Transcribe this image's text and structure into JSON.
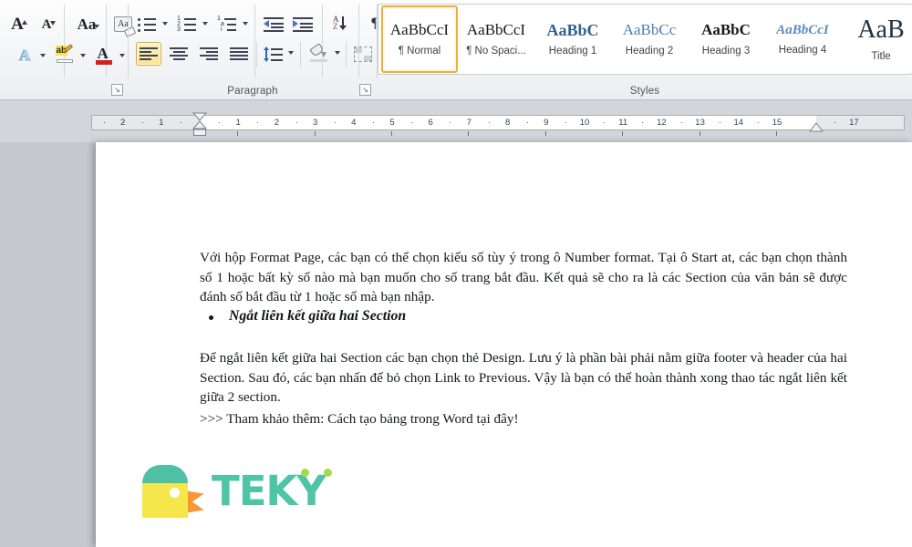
{
  "app": {
    "name": "Microsoft Word 2010 ribbon"
  },
  "ribbon": {
    "font_group": {
      "label": "",
      "buttons": [
        {
          "name": "grow-font",
          "glyph": "A"
        },
        {
          "name": "shrink-font",
          "glyph": "A"
        },
        {
          "name": "change-case",
          "glyph": "Aa"
        },
        {
          "name": "clear-formatting",
          "glyph": "A"
        },
        {
          "name": "text-effects",
          "glyph": "A"
        },
        {
          "name": "text-highlight-color",
          "glyph": "ab"
        },
        {
          "name": "font-color",
          "glyph": "A"
        }
      ]
    },
    "paragraph_group": {
      "label": "Paragraph",
      "row1": [
        "bullets",
        "numbering",
        "multilevel-list",
        "decrease-indent",
        "increase-indent",
        "sort",
        "show-formatting-marks"
      ],
      "row2": [
        "align-left",
        "center",
        "align-right",
        "justify",
        "line-spacing",
        "shading",
        "borders"
      ],
      "active": "align-left",
      "pilcrow": "¶",
      "sort_letters": {
        "top": "A",
        "bottom": "Z"
      }
    },
    "styles_group": {
      "label": "Styles",
      "items": [
        {
          "sample": "AaBbCcI",
          "name": "¶ Normal",
          "selected": true,
          "style": "normal"
        },
        {
          "sample": "AaBbCcI",
          "name": "¶ No Spaci...",
          "selected": false,
          "style": "nospacing"
        },
        {
          "sample": "AaBbC",
          "name": "Heading 1",
          "selected": false,
          "style": "h1"
        },
        {
          "sample": "AaBbCc",
          "name": "Heading 2",
          "selected": false,
          "style": "h2"
        },
        {
          "sample": "AaBbC",
          "name": "Heading 3",
          "selected": false,
          "style": "h3"
        },
        {
          "sample": "AaBbCcI",
          "name": "Heading 4",
          "selected": false,
          "style": "h4"
        },
        {
          "sample": "AaB",
          "name": "Title",
          "selected": false,
          "style": "title"
        }
      ]
    },
    "colors": {
      "selection_border": "#e0a829",
      "selection_fill": "#fbe293",
      "heading_blue": "#3a6ea5",
      "font_color_bar": "#d61f1f",
      "highlight_yellow": "#f7e64a"
    }
  },
  "ruler": {
    "left_labels": [
      "2",
      "1"
    ],
    "labels": [
      "1",
      "2",
      "3",
      "4",
      "5",
      "6",
      "7",
      "8",
      "9",
      "10",
      "11",
      "12",
      "13",
      "14",
      "15",
      "17"
    ],
    "left_indent_marker": "hourglass",
    "right_indent_marker": "triangle"
  },
  "document": {
    "paragraph1": "Với hộp Format Page, các bạn có thể chọn kiểu số tùy ý trong ô Number format. Tại ô Start at, các bạn chọn thành số 1 hoặc bất kỳ số nào mà bạn muốn cho số trang bắt đầu. Kết quả sẽ cho ra là các Section của văn bản sẽ được đánh số bắt đầu từ 1 hoặc số mà bạn nhập.",
    "bullet1": "Ngắt liên kết giữa hai Section",
    "paragraph2": "Để ngắt liên kết giữa hai Section các bạn chọn thẻ Design. Lưu ý là phần bài phải nằm giữa footer và header của hai Section. Sau đó, các bạn nhấn để bỏ chọn Link to Previous. Vậy là bạn có thể hoàn thành xong thao tác ngắt liên kết giữa 2 section.",
    "paragraph3": ">>> Tham khảo thêm: Cách tạo bảng trong Word tại đây!"
  },
  "logo": {
    "text": "TEKY",
    "colors": {
      "teal": "#4ec5a6",
      "yellow": "#f5e64b",
      "orange": "#f3922f",
      "green_dot": "#a8d94b"
    }
  }
}
